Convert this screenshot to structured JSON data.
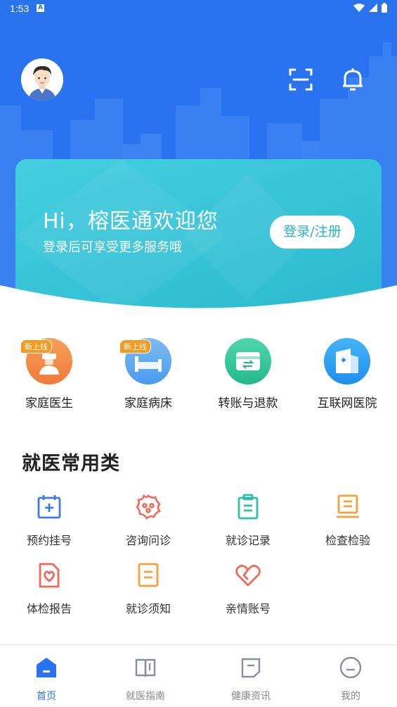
{
  "status_bar": {
    "time": "1:53",
    "notification_letter": "A"
  },
  "header": {
    "avatar_icon": "user-avatar",
    "scan_icon": "scan-icon",
    "bell_icon": "bell-icon"
  },
  "welcome": {
    "title": "Hi，榕医通欢迎您",
    "subtitle": "登录后可享受更多服务哦",
    "login_label": "登录/注册"
  },
  "quick_actions": [
    {
      "label": "家庭医生",
      "badge": "新上线",
      "icon": "family-doctor-icon",
      "color": "#f5803e"
    },
    {
      "label": "家庭病床",
      "badge": "新上线",
      "icon": "family-bed-icon",
      "color": "#5aa8f2"
    },
    {
      "label": "转账与退款",
      "badge": "",
      "icon": "transfer-refund-icon",
      "color": "#33c79b"
    },
    {
      "label": "互联网医院",
      "badge": "",
      "icon": "internet-hospital-icon",
      "color": "#2f9ff0"
    }
  ],
  "common_section": {
    "title": "就医常用类",
    "items": [
      {
        "label": "预约挂号",
        "icon": "calendar-plus-icon",
        "color": "#3a7de8"
      },
      {
        "label": "咨询问诊",
        "icon": "consult-icon",
        "color": "#f06a5a"
      },
      {
        "label": "就诊记录",
        "icon": "clipboard-icon",
        "color": "#2fbfae"
      },
      {
        "label": "检查检验",
        "icon": "inspection-icon",
        "color": "#f5a03a"
      },
      {
        "label": "体检报告",
        "icon": "report-heart-icon",
        "color": "#f06a5a"
      },
      {
        "label": "就诊须知",
        "icon": "notice-icon",
        "color": "#f5a03a"
      },
      {
        "label": "亲情账号",
        "icon": "heart-icon",
        "color": "#f06a5a"
      }
    ]
  },
  "tabbar": {
    "active_color": "#2a73f0",
    "tabs": [
      {
        "label": "首页",
        "icon": "home-icon",
        "active": true
      },
      {
        "label": "就医指南",
        "icon": "book-icon",
        "active": false
      },
      {
        "label": "健康资讯",
        "icon": "news-icon",
        "active": false
      },
      {
        "label": "我的",
        "icon": "profile-icon",
        "active": false
      }
    ]
  }
}
